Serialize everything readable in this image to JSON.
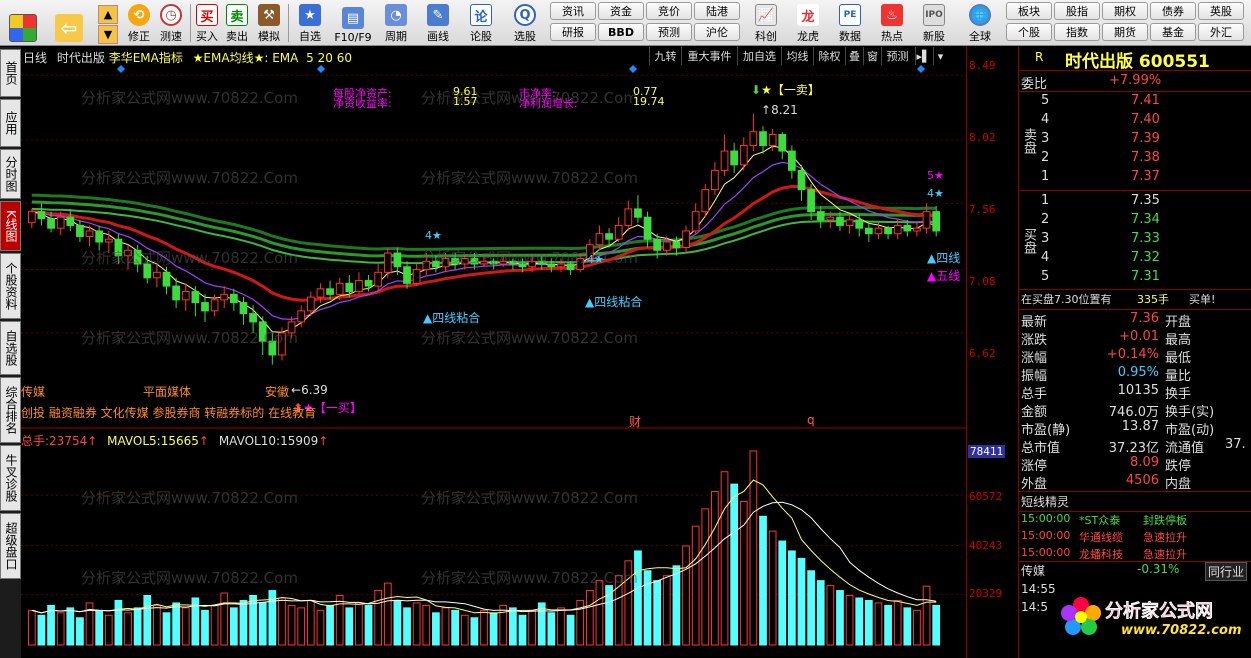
{
  "toolbar": {
    "nav": [
      {
        "label": "修正"
      },
      {
        "label": "测速"
      }
    ],
    "trade": [
      {
        "label": "买入"
      },
      {
        "label": "卖出"
      },
      {
        "label": "模拟"
      }
    ],
    "main": [
      {
        "label": "自选"
      },
      {
        "label": "F10/F9"
      },
      {
        "label": "周期"
      },
      {
        "label": "画线"
      },
      {
        "label": "论股"
      },
      {
        "label": "选股"
      }
    ],
    "grid_top": [
      "资讯",
      "资金",
      "竞价",
      "陆港"
    ],
    "grid_bottom": [
      "研报",
      "BBD",
      "预测",
      "沪伦"
    ],
    "mid": [
      {
        "label": "科创"
      },
      {
        "label": "龙虎"
      },
      {
        "label": "数据"
      },
      {
        "label": "热点"
      },
      {
        "label": "新股"
      }
    ],
    "globe": "全球",
    "right_top": [
      "板块",
      "股指",
      "期权",
      "债券",
      "英股"
    ],
    "right_bottom": [
      "个股",
      "指数",
      "期货",
      "基金",
      "外汇"
    ]
  },
  "sidebar": [
    "首页",
    "应用",
    "分时图",
    "K线图",
    "个股资料",
    "自选股",
    "综合排名",
    "牛叉诊股",
    "超级盘口"
  ],
  "chart_header": {
    "period": "日线",
    "name": "时代出版",
    "indicator": "李华EMA指标",
    "ema_label": "★EMA均线★: EMA",
    "ema_params": "5  20  60"
  },
  "chart_tabs": [
    "九转",
    "重大事件",
    "加自选",
    "均线",
    "除权",
    "叠",
    "窗",
    "预测"
  ],
  "fin": {
    "mgjzc_label": "每股净资产:",
    "mgjzc": "9.61",
    "sjl_label": "市净率:",
    "sjl": "0.77",
    "jzcsyl_label": "净资收益率:",
    "jzcsyl": "1.57",
    "jlrzzl_label": "净利润增长:",
    "jlrzzl": "19.74"
  },
  "annotations": {
    "high": "8.21",
    "sell": "【一卖】",
    "low": "6.39",
    "buy": "【一买】",
    "sig1": "四线粘合",
    "sig2": "四线粘合",
    "sig3": "四线",
    "sig4": "五线",
    "n4a": "4",
    "n4b": "4",
    "n4c": "4",
    "n5": "5",
    "cai": "财",
    "q": "q"
  },
  "sectors": {
    "chuanmei": "传媒",
    "pmmt": "平面媒体",
    "anhui": "安徽",
    "list": "创投  融资融券  文化传媒  参股券商  转融券标的  在线教育"
  },
  "vol_header": {
    "total_label": "总手:",
    "total": "23754",
    "mavol5_label": "MAVOL5:",
    "mavol5": "15665",
    "mavol10_label": "MAVOL10:",
    "mavol10": "15909"
  },
  "price_axis": [
    "8.49",
    "8.02",
    "7.56",
    "7.08",
    "6.62"
  ],
  "vol_axis": [
    "78411",
    "60572",
    "40243",
    "20329"
  ],
  "quote": {
    "header": "R",
    "title": "时代出版  600551",
    "webi_label": "委比",
    "webi": "+7.99%",
    "sell": [
      {
        "lvl": "5",
        "price": "7.41"
      },
      {
        "lvl": "4",
        "price": "7.40"
      },
      {
        "lvl": "3",
        "price": "7.39"
      },
      {
        "lvl": "2",
        "price": "7.38"
      },
      {
        "lvl": "1",
        "price": "7.37"
      }
    ],
    "buy": [
      {
        "lvl": "1",
        "price": "7.35"
      },
      {
        "lvl": "2",
        "price": "7.34"
      },
      {
        "lvl": "3",
        "price": "7.33"
      },
      {
        "lvl": "4",
        "price": "7.32"
      },
      {
        "lvl": "5",
        "price": "7.31"
      }
    ],
    "sell_group": "卖盘",
    "buy_group": "买盘",
    "bid_line": "在买盘7.30位置有",
    "bid_amt": "335手",
    "bid_tag": "买单!",
    "stats": [
      {
        "k": "最新",
        "v": "7.36",
        "k2": "开盘",
        "v2": ""
      },
      {
        "k": "涨跌",
        "v": "+0.01",
        "k2": "最高",
        "v2": ""
      },
      {
        "k": "涨幅",
        "v": "+0.14%",
        "k2": "最低",
        "v2": ""
      },
      {
        "k": "振幅",
        "v": "0.95%",
        "k2": "量比",
        "v2": ""
      },
      {
        "k": "总手",
        "v": "10135",
        "k2": "换手",
        "v2": ""
      },
      {
        "k": "金额",
        "v": "746.0万",
        "k2": "换手(实)",
        "v2": ""
      },
      {
        "k": "市盈(静)",
        "v": "13.87",
        "k2": "市盈(动)",
        "v2": ""
      },
      {
        "k": "总市值",
        "v": "37.23亿",
        "k2": "流通值",
        "v2": "37."
      },
      {
        "k": "涨停",
        "v": "8.09",
        "k2": "跌停",
        "v2": ""
      },
      {
        "k": "外盘",
        "v": "4506",
        "k2": "内盘",
        "v2": ""
      }
    ],
    "short_title": "短线精灵",
    "short": [
      {
        "t": "15:00:00",
        "n": "*ST众泰",
        "e": "封跌停板"
      },
      {
        "t": "15:00:00",
        "n": "华通线缆",
        "e": "急速拉升"
      },
      {
        "t": "15:00:00",
        "n": "龙蟠科技",
        "e": "急速拉升"
      }
    ],
    "sector_name": "传媒",
    "sector_chg": "-0.31%",
    "same_ind": "同行业",
    "tick1": "14:55",
    "tick2": "14:5"
  },
  "watermark": "分析家公式网www.70822.Com",
  "logo": {
    "cn": "分析家公式网",
    "url": "www.70822.com"
  },
  "colors": {
    "up": "#ff3232",
    "down": "#54ffff",
    "accent": "#ffff00"
  },
  "chart_data": {
    "type": "candlestick",
    "y_range": [
      6.39,
      8.49
    ],
    "candles": [
      [
        7.42,
        7.5,
        7.52,
        7.38
      ],
      [
        7.5,
        7.45,
        7.56,
        7.4
      ],
      [
        7.45,
        7.38,
        7.5,
        7.35
      ],
      [
        7.38,
        7.46,
        7.5,
        7.33
      ],
      [
        7.46,
        7.4,
        7.52,
        7.36
      ],
      [
        7.4,
        7.32,
        7.44,
        7.28
      ],
      [
        7.32,
        7.36,
        7.4,
        7.25
      ],
      [
        7.36,
        7.28,
        7.4,
        7.22
      ],
      [
        7.28,
        7.3,
        7.36,
        7.2
      ],
      [
        7.3,
        7.18,
        7.34,
        7.12
      ],
      [
        7.18,
        7.22,
        7.26,
        7.08
      ],
      [
        7.22,
        7.12,
        7.26,
        7.06
      ],
      [
        7.12,
        7.02,
        7.18,
        6.98
      ],
      [
        7.02,
        7.06,
        7.12,
        6.95
      ],
      [
        7.06,
        6.96,
        7.1,
        6.9
      ],
      [
        6.96,
        6.86,
        7.02,
        6.8
      ],
      [
        6.86,
        6.92,
        6.98,
        6.78
      ],
      [
        6.92,
        6.84,
        6.96,
        6.74
      ],
      [
        6.84,
        6.78,
        6.9,
        6.7
      ],
      [
        6.78,
        6.86,
        6.9,
        6.74
      ],
      [
        6.86,
        6.9,
        6.96,
        6.8
      ],
      [
        6.9,
        6.84,
        6.94,
        6.78
      ],
      [
        6.84,
        6.76,
        6.88,
        6.68
      ],
      [
        6.76,
        6.7,
        6.82,
        6.62
      ],
      [
        6.7,
        6.56,
        6.74,
        6.46
      ],
      [
        6.56,
        6.46,
        6.62,
        6.39
      ],
      [
        6.46,
        6.62,
        6.66,
        6.42
      ],
      [
        6.62,
        6.7,
        6.74,
        6.58
      ],
      [
        6.7,
        6.78,
        6.82,
        6.66
      ],
      [
        6.78,
        6.88,
        6.92,
        6.74
      ],
      [
        6.88,
        6.94,
        6.98,
        6.84
      ],
      [
        6.94,
        6.9,
        7.0,
        6.86
      ],
      [
        6.9,
        6.98,
        7.02,
        6.86
      ],
      [
        6.98,
        6.92,
        7.04,
        6.88
      ],
      [
        6.92,
        7.0,
        7.06,
        6.9
      ],
      [
        7.0,
        6.96,
        7.04,
        6.92
      ],
      [
        6.96,
        7.06,
        7.12,
        6.92
      ],
      [
        7.06,
        7.2,
        7.24,
        7.02
      ],
      [
        7.2,
        7.1,
        7.24,
        7.04
      ],
      [
        7.1,
        6.98,
        7.14,
        6.94
      ],
      [
        6.98,
        7.08,
        7.12,
        6.96
      ],
      [
        7.08,
        7.14,
        7.2,
        7.04
      ],
      [
        7.14,
        7.1,
        7.18,
        7.06
      ],
      [
        7.1,
        7.16,
        7.2,
        7.06
      ],
      [
        7.16,
        7.12,
        7.2,
        7.08
      ],
      [
        7.12,
        7.16,
        7.18,
        7.08
      ],
      [
        7.16,
        7.12,
        7.2,
        7.08
      ],
      [
        7.12,
        7.14,
        7.18,
        7.1
      ],
      [
        7.14,
        7.12,
        7.16,
        7.08
      ],
      [
        7.12,
        7.14,
        7.18,
        7.1
      ],
      [
        7.14,
        7.12,
        7.16,
        7.08
      ],
      [
        7.12,
        7.1,
        7.16,
        7.06
      ],
      [
        7.1,
        7.14,
        7.18,
        7.06
      ],
      [
        7.14,
        7.12,
        7.18,
        7.08
      ],
      [
        7.12,
        7.1,
        7.16,
        7.06
      ],
      [
        7.1,
        7.12,
        7.16,
        7.06
      ],
      [
        7.12,
        7.08,
        7.14,
        7.04
      ],
      [
        7.08,
        7.16,
        7.2,
        7.06
      ],
      [
        7.16,
        7.26,
        7.3,
        7.14
      ],
      [
        7.26,
        7.34,
        7.4,
        7.22
      ],
      [
        7.34,
        7.3,
        7.38,
        7.24
      ],
      [
        7.3,
        7.4,
        7.46,
        7.28
      ],
      [
        7.4,
        7.52,
        7.58,
        7.36
      ],
      [
        7.52,
        7.46,
        7.62,
        7.42
      ],
      [
        7.46,
        7.3,
        7.5,
        7.24
      ],
      [
        7.3,
        7.22,
        7.34,
        7.16
      ],
      [
        7.22,
        7.28,
        7.32,
        7.18
      ],
      [
        7.28,
        7.24,
        7.32,
        7.18
      ],
      [
        7.24,
        7.36,
        7.4,
        7.2
      ],
      [
        7.36,
        7.5,
        7.56,
        7.34
      ],
      [
        7.5,
        7.66,
        7.7,
        7.46
      ],
      [
        7.66,
        7.8,
        7.86,
        7.62
      ],
      [
        7.8,
        7.94,
        8.06,
        7.76
      ],
      [
        7.94,
        7.84,
        8.0,
        7.78
      ],
      [
        7.84,
        7.98,
        8.04,
        7.8
      ],
      [
        7.98,
        8.08,
        8.21,
        7.94
      ],
      [
        8.08,
        7.98,
        8.12,
        7.92
      ],
      [
        7.98,
        8.06,
        8.1,
        7.94
      ],
      [
        8.06,
        7.94,
        8.08,
        7.88
      ],
      [
        7.94,
        7.8,
        7.98,
        7.74
      ],
      [
        7.8,
        7.66,
        7.84,
        7.58
      ],
      [
        7.66,
        7.5,
        7.7,
        7.44
      ],
      [
        7.5,
        7.44,
        7.54,
        7.38
      ],
      [
        7.44,
        7.46,
        7.5,
        7.38
      ],
      [
        7.46,
        7.4,
        7.5,
        7.36
      ],
      [
        7.4,
        7.44,
        7.48,
        7.34
      ],
      [
        7.44,
        7.38,
        7.48,
        7.32
      ],
      [
        7.38,
        7.34,
        7.42,
        7.28
      ],
      [
        7.34,
        7.38,
        7.42,
        7.3
      ],
      [
        7.38,
        7.34,
        7.4,
        7.3
      ],
      [
        7.34,
        7.4,
        7.44,
        7.3
      ],
      [
        7.4,
        7.36,
        7.44,
        7.32
      ],
      [
        7.36,
        7.38,
        7.42,
        7.32
      ],
      [
        7.38,
        7.5,
        7.56,
        7.34
      ],
      [
        7.5,
        7.36,
        7.54,
        7.32
      ]
    ],
    "volume": [
      14000,
      12000,
      16000,
      13000,
      15000,
      11000,
      17000,
      14000,
      12000,
      18000,
      13000,
      15000,
      20000,
      16000,
      13000,
      17000,
      15000,
      19000,
      14000,
      16000,
      21000,
      15000,
      18000,
      20000,
      17000,
      22000,
      19000,
      16000,
      15000,
      18000,
      14000,
      16000,
      20000,
      15000,
      17000,
      16000,
      22000,
      25000,
      18000,
      15000,
      17000,
      16000,
      13000,
      15000,
      14000,
      12000,
      11000,
      14000,
      13000,
      16000,
      15000,
      12000,
      14000,
      17000,
      13000,
      15000,
      12000,
      18000,
      22000,
      26000,
      24000,
      28000,
      34000,
      38000,
      30000,
      26000,
      28000,
      32000,
      40000,
      48000,
      55000,
      62000,
      70000,
      65000,
      58000,
      78411,
      52000,
      46000,
      42000,
      38000,
      35000,
      30000,
      26000,
      24000,
      22000,
      20000,
      19000,
      18000,
      17000,
      16000,
      18000,
      15000,
      14000,
      23754,
      16000
    ],
    "volume_ticks": [
      78411,
      60572,
      40243,
      20329
    ]
  }
}
